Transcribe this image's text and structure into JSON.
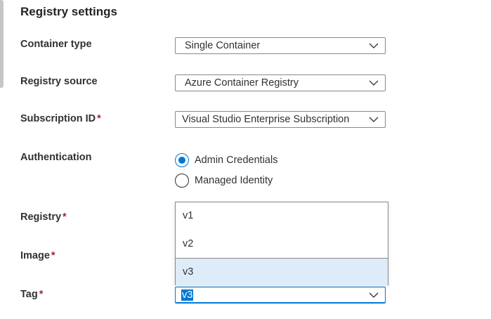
{
  "section": {
    "title": "Registry settings"
  },
  "fields": {
    "container_type": {
      "label": "Container type",
      "value": "Single Container"
    },
    "registry_source": {
      "label": "Registry source",
      "value": "Azure Container Registry"
    },
    "subscription": {
      "label": "Subscription ID",
      "required_mark": "*",
      "value": "Visual Studio Enterprise Subscription"
    },
    "authentication": {
      "label": "Authentication",
      "options": [
        {
          "label": "Admin Credentials",
          "checked": true
        },
        {
          "label": "Managed Identity",
          "checked": false
        }
      ]
    },
    "registry": {
      "label": "Registry",
      "required_mark": "*"
    },
    "image": {
      "label": "Image",
      "required_mark": "*"
    },
    "tag": {
      "label": "Tag",
      "required_mark": "*",
      "value": "v3",
      "options": [
        "v1",
        "v2",
        "v3"
      ],
      "highlighted": "v3"
    }
  },
  "colors": {
    "accent": "#0078d4",
    "required": "#a4262c",
    "option_highlight": "#deecf9",
    "border": "#8a8886"
  },
  "icons": {
    "dropdown": "chevron-down-icon"
  }
}
